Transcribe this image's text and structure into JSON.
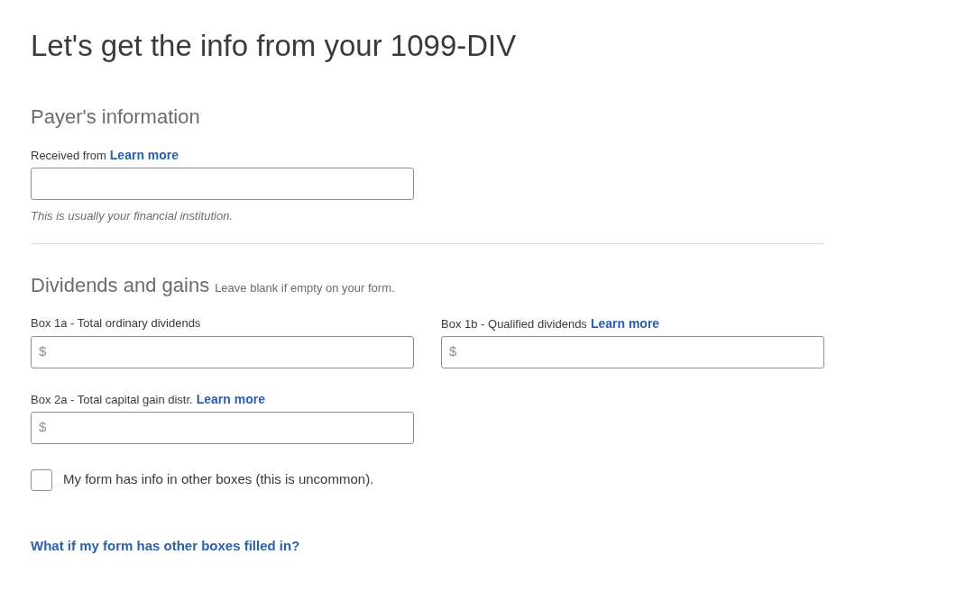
{
  "title": "Let's get the info from your 1099-DIV",
  "payer": {
    "heading": "Payer's information",
    "field": {
      "label": "Received from",
      "link": "Learn more",
      "hint": "This is usually your financial institution."
    }
  },
  "dividends": {
    "heading": "Dividends and gains",
    "note": "Leave blank if empty on your form.",
    "fields": [
      {
        "label": "Box 1a - Total ordinary dividends",
        "prefix": "$"
      },
      {
        "label": "Box 1b - Qualified dividends",
        "link": "Learn more",
        "prefix": "$"
      },
      {
        "label": "Box 2a - Total capital gain distr.",
        "link": "Learn more",
        "prefix": "$"
      }
    ]
  },
  "other_boxes": {
    "label": "My form has info in other boxes (this is uncommon).",
    "checked": false
  },
  "help_link": "What if my form has other boxes filled in?"
}
